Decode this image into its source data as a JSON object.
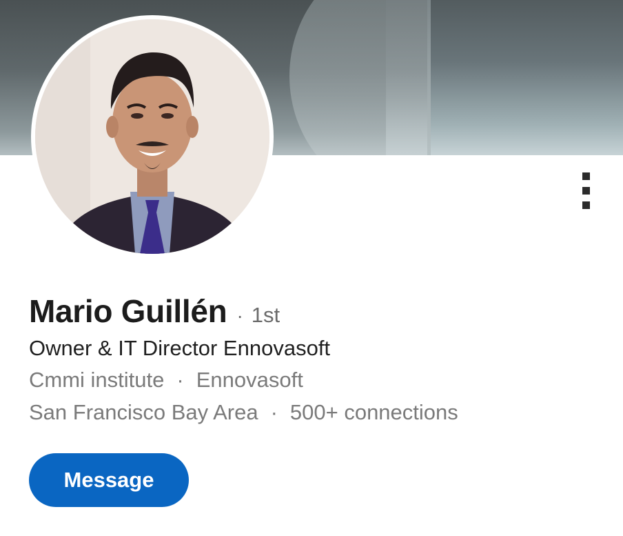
{
  "profile": {
    "name": "Mario Guillén",
    "connection_dot": "·",
    "connection_degree": "1st",
    "headline": "Owner & IT Director Ennovasoft",
    "education": "Cmmi institute",
    "company": "Ennovasoft",
    "location": "San Francisco Bay Area",
    "connections": "500+ connections",
    "separator": "·"
  },
  "actions": {
    "message_label": "Message",
    "more_icon": "more-vertical-icon"
  },
  "colors": {
    "primary_button": "#0a66c2",
    "name_text": "#1c1c1c",
    "secondary_text": "#7a7a7a"
  }
}
